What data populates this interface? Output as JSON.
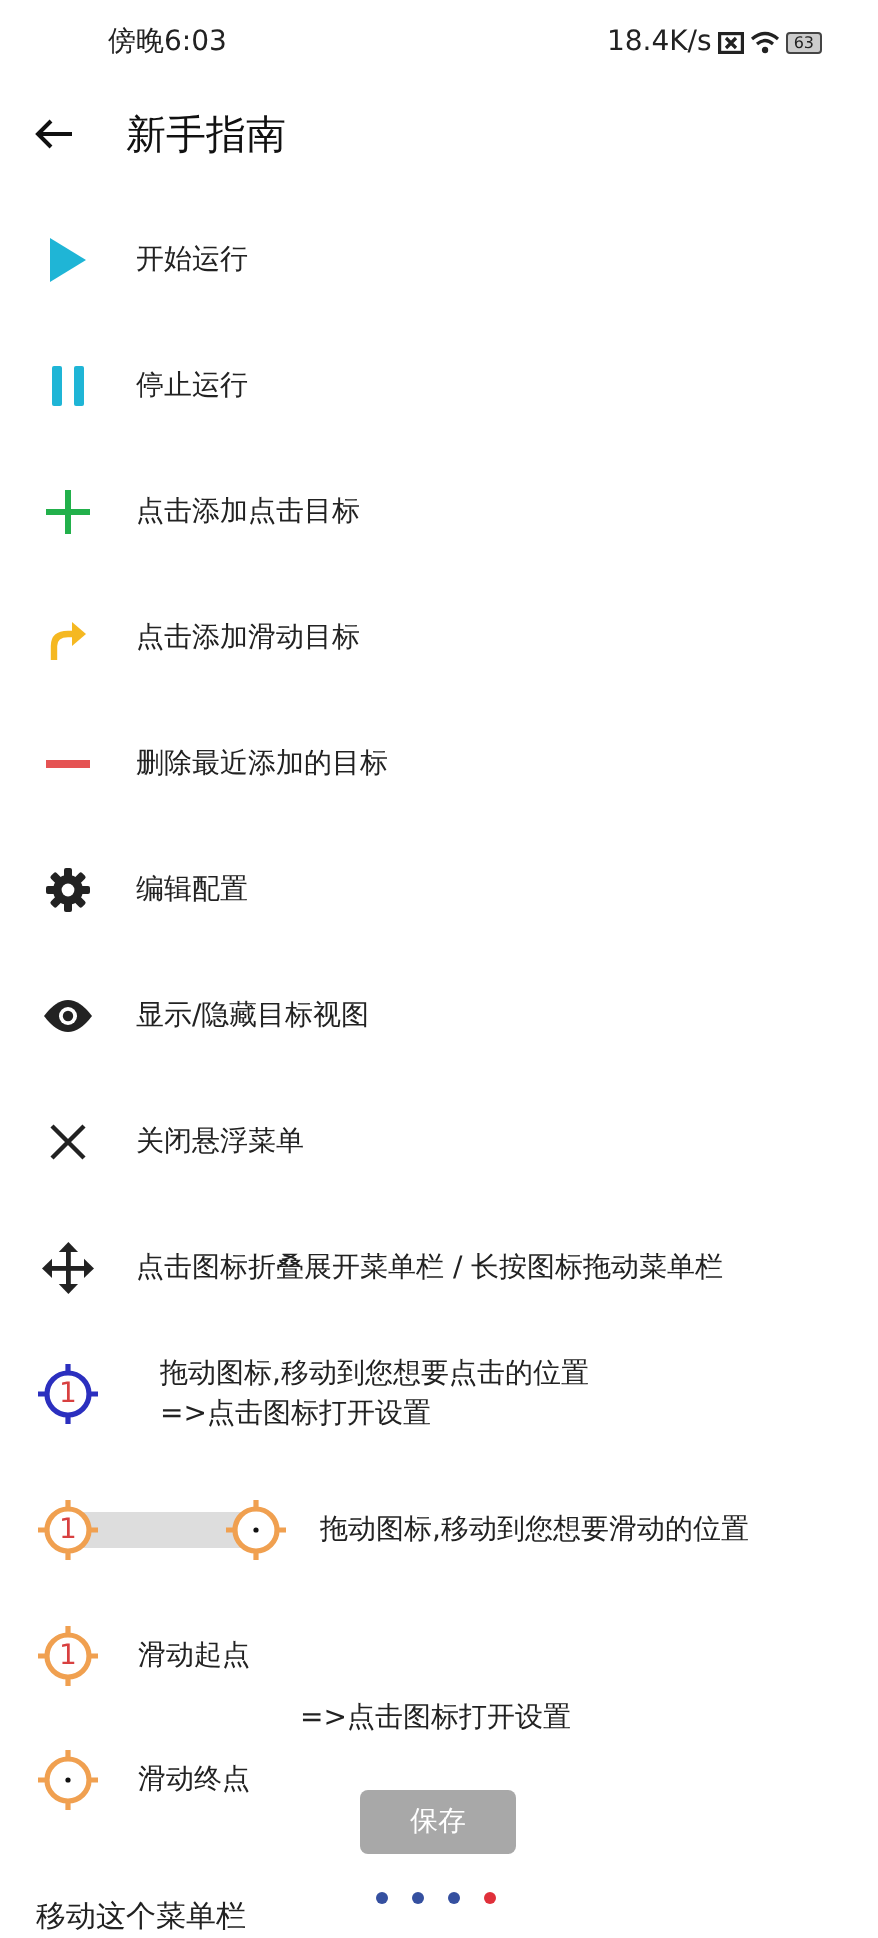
{
  "status_bar": {
    "time": "傍晚6:03",
    "speed": "18.4K/s",
    "battery": "63"
  },
  "header": {
    "title": "新手指南"
  },
  "items": [
    {
      "kind": "play",
      "label": "开始运行"
    },
    {
      "kind": "pause",
      "label": "停止运行"
    },
    {
      "kind": "plus",
      "label": "点击添加点击目标"
    },
    {
      "kind": "swipe",
      "label": "点击添加滑动目标"
    },
    {
      "kind": "minus",
      "label": "删除最近添加的目标"
    },
    {
      "kind": "gear",
      "label": "编辑配置"
    },
    {
      "kind": "eye",
      "label": "显示/隐藏目标视图"
    },
    {
      "kind": "close",
      "label": "关闭悬浮菜单"
    },
    {
      "kind": "move",
      "label": "点击图标折叠展开菜单栏 / 长按图标拖动菜单栏"
    }
  ],
  "click_target": {
    "marker": "1",
    "lines": [
      "拖动图标,移动到您想要点击的位置",
      "=>点击图标打开设置"
    ]
  },
  "swipe_demo": {
    "marker": "1",
    "label": "拖动图标,移动到您想要滑动的位置"
  },
  "swipe_start": {
    "marker": "1",
    "label": "滑动起点"
  },
  "settings_hint": "=>点击图标打开设置",
  "swipe_end": {
    "label": "滑动终点"
  },
  "save_button": {
    "label": "保存",
    "disabled": true
  },
  "pager": [
    {
      "selected": false
    },
    {
      "selected": false
    },
    {
      "selected": false
    },
    {
      "selected": true
    }
  ],
  "move_label": "移动这个菜单栏"
}
